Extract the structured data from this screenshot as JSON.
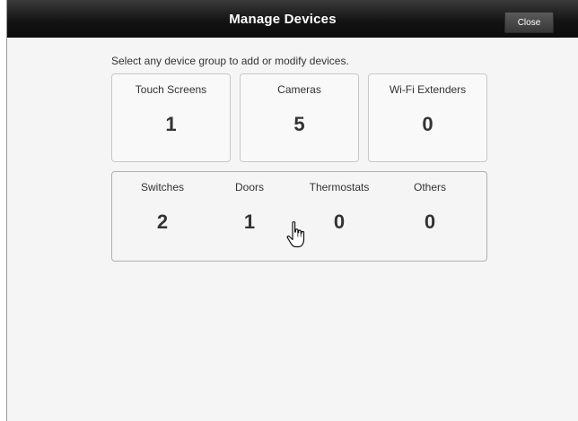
{
  "window": {
    "title": "Manage Devices",
    "close_label": "Close"
  },
  "instructions": "Select any device group to add or modify devices.",
  "device_groups": [
    {
      "label": "Touch Screens",
      "count": "1"
    },
    {
      "label": "Cameras",
      "count": "5"
    },
    {
      "label": "Wi-Fi Extenders",
      "count": "0"
    }
  ],
  "misc_group": [
    {
      "label": "Switches",
      "count": "2"
    },
    {
      "label": "Doors",
      "count": "1"
    },
    {
      "label": "Thermostats",
      "count": "0"
    },
    {
      "label": "Others",
      "count": "0"
    }
  ],
  "cursor": {
    "icon": "hand-pointer-icon"
  }
}
